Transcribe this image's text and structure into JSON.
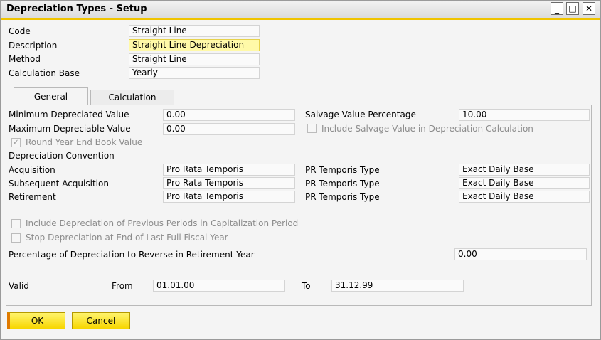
{
  "window": {
    "title": "Depreciation Types - Setup",
    "minimize": "_",
    "maximize": "□",
    "close": "✕"
  },
  "header": {
    "code": {
      "label": "Code",
      "value": "Straight Line"
    },
    "description": {
      "label": "Description",
      "value": "Straight Line Depreciation"
    },
    "method": {
      "label": "Method",
      "value": "Straight Line"
    },
    "calculation_base": {
      "label": "Calculation Base",
      "value": "Yearly"
    }
  },
  "tabs": [
    "General",
    "Calculation"
  ],
  "general": {
    "min_depreciated": {
      "label": "Minimum Depreciated Value",
      "value": "0.00"
    },
    "max_depreciable": {
      "label": "Maximum Depreciable Value",
      "value": "0.00"
    },
    "salvage_pct": {
      "label": "Salvage Value Percentage",
      "value": "10.00"
    },
    "include_salvage": {
      "label": "Include Salvage Value in Depreciation Calculation",
      "checked": false
    },
    "round_year_end": {
      "label": "Round Year End Book Value",
      "checked": true
    },
    "convention_heading": "Depreciation Convention",
    "conventions": [
      {
        "label": "Acquisition",
        "value": "Pro Rata Temporis",
        "type_label": "PR Temporis Type",
        "type_value": "Exact Daily Base"
      },
      {
        "label": "Subsequent Acquisition",
        "value": "Pro Rata Temporis",
        "type_label": "PR Temporis Type",
        "type_value": "Exact Daily Base"
      },
      {
        "label": "Retirement",
        "value": "Pro Rata Temporis",
        "type_label": "PR Temporis Type",
        "type_value": "Exact Daily Base"
      }
    ],
    "include_prev_periods": {
      "label": "Include Depreciation of Previous Periods in Capitalization Period",
      "checked": false
    },
    "stop_depreciation": {
      "label": "Stop Depreciation at End of Last Full Fiscal Year",
      "checked": false
    },
    "reverse_pct": {
      "label": "Percentage of Depreciation to Reverse in Retirement Year",
      "value": "0.00"
    },
    "valid": {
      "label": "Valid",
      "from_label": "From",
      "from_value": "01.01.00",
      "to_label": "To",
      "to_value": "31.12.99"
    }
  },
  "buttons": {
    "ok": "OK",
    "cancel": "Cancel"
  }
}
